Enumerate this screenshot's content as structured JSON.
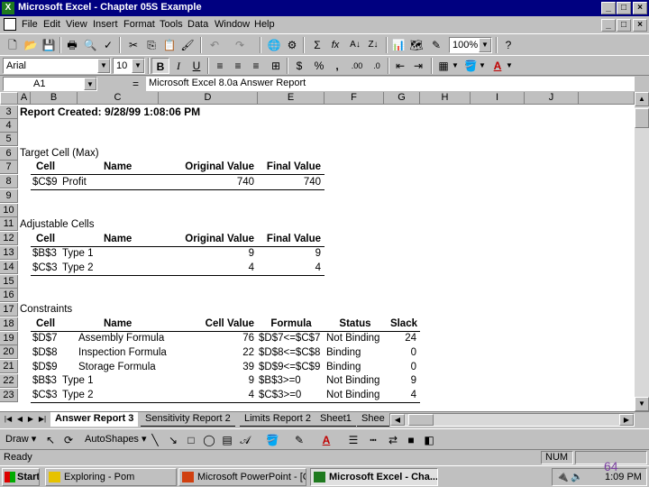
{
  "window": {
    "title": "Microsoft Excel - Chapter 05S Example",
    "controls": [
      "_",
      "□",
      "×"
    ]
  },
  "menu": [
    "File",
    "Edit",
    "View",
    "Insert",
    "Format",
    "Tools",
    "Data",
    "Window",
    "Help"
  ],
  "toolbar": {
    "zoom": "100%",
    "font": "Arial",
    "font_size": "10",
    "bold": "B",
    "italic": "I",
    "underline": "U",
    "currency": "$",
    "percent": "%",
    "comma": ",",
    "inc_decimal": ".00",
    "dec_decimal": ".0",
    "autosum": "Σ",
    "function": "fx"
  },
  "formula_bar": {
    "name_box": "A1",
    "equals": "=",
    "content": "Microsoft Excel 8.0a Answer Report"
  },
  "columns": [
    "A",
    "B",
    "C",
    "D",
    "E",
    "F",
    "G",
    "H",
    "I",
    "J"
  ],
  "rows": [
    "3",
    "4",
    "5",
    "6",
    "7",
    "8",
    "9",
    "10",
    "11",
    "12",
    "13",
    "14",
    "15",
    "16",
    "17",
    "18",
    "19",
    "20",
    "21",
    "22",
    "23"
  ],
  "sheet": {
    "report_created": "Report Created: 9/28/99 1:08:06 PM",
    "target": {
      "title": "Target Cell (Max)",
      "headers": [
        "Cell",
        "Name",
        "Original Value",
        "Final Value"
      ],
      "rows": [
        [
          "$C$9",
          "Profit",
          "740",
          "740"
        ]
      ]
    },
    "adjustable": {
      "title": "Adjustable Cells",
      "headers": [
        "Cell",
        "Name",
        "Original Value",
        "Final Value"
      ],
      "rows": [
        [
          "$B$3",
          "Type 1",
          "9",
          "9"
        ],
        [
          "$C$3",
          "Type 2",
          "4",
          "4"
        ]
      ]
    },
    "constraints": {
      "title": "Constraints",
      "headers": [
        "Cell",
        "Name",
        "Cell Value",
        "Formula",
        "Status",
        "Slack"
      ],
      "rows": [
        [
          "$D$7",
          "Assembly Formula",
          "76",
          "$D$7<=$C$7",
          "Not Binding",
          "24"
        ],
        [
          "$D$8",
          "Inspection Formula",
          "22",
          "$D$8<=$C$8",
          "Binding",
          "0"
        ],
        [
          "$D$9",
          "Storage Formula",
          "39",
          "$D$9<=$C$9",
          "Binding",
          "0"
        ],
        [
          "$B$3",
          "Type 1",
          "9",
          "$B$3>=0",
          "Not Binding",
          "9"
        ],
        [
          "$C$3",
          "Type 2",
          "4",
          "$C$3>=0",
          "Not Binding",
          "4"
        ]
      ]
    }
  },
  "tabs": [
    "Answer Report 3",
    "Sensitivity Report 2",
    "Limits Report 2",
    "Sheet1",
    "Shee"
  ],
  "drawbar": {
    "draw": "Draw",
    "autoshapes": "AutoShapes"
  },
  "status": {
    "text": "Ready",
    "num": "NUM"
  },
  "taskbar": {
    "start": "Start",
    "tasks": [
      "Exploring - Pom",
      "Microsoft PowerPoint - [Ch...",
      "Microsoft Excel - Cha..."
    ],
    "clock": "1:09 PM",
    "page_number": "64"
  },
  "colors": {
    "title_bar": "#000080",
    "page_number": "#7b3fa0"
  }
}
